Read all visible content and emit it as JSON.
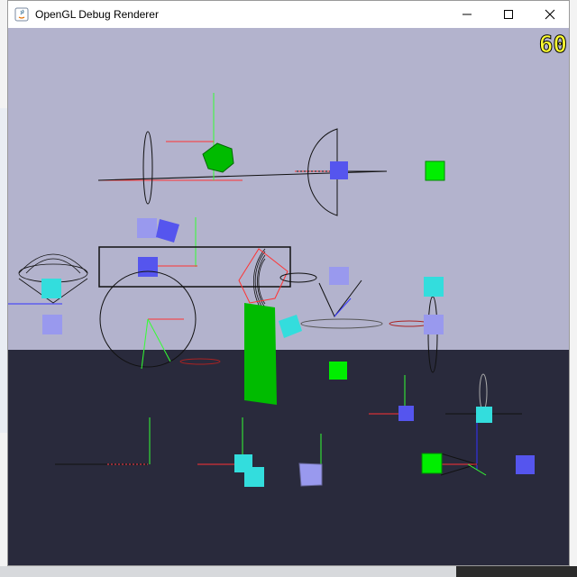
{
  "window": {
    "title": "OpenGL Debug Renderer",
    "app_icon": "java-icon",
    "controls": [
      "minimize-icon",
      "maximize-icon",
      "close-icon"
    ]
  },
  "hud": {
    "fps_value": "60",
    "fps_color": "#ffff33"
  },
  "scene": {
    "sky_color": "#b3b3cd",
    "ground_color": "#292a3c",
    "cube_colors": {
      "green": "#00cc00",
      "blue": "#5555ee",
      "light_blue": "#9999ee",
      "cyan": "#33dddd"
    },
    "axis_colors": {
      "x": "#ff3333",
      "y": "#33ff33",
      "z": "#3333ff"
    }
  }
}
